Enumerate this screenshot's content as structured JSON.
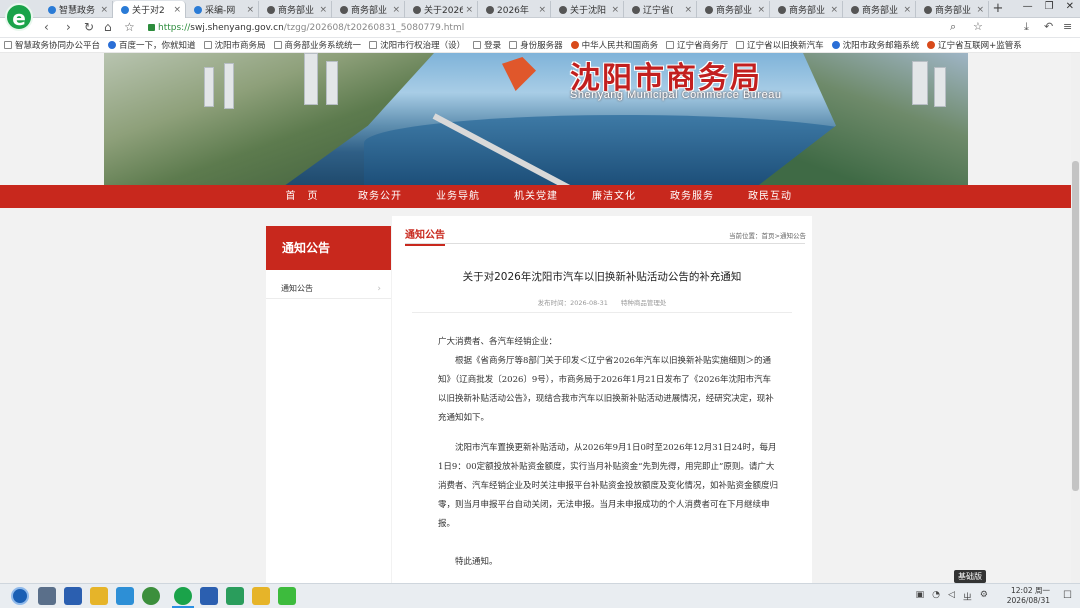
{
  "browser": {
    "logo_letter": "e",
    "tabs": [
      {
        "label": "智慧政务",
        "close": "×"
      },
      {
        "label": "关于对2",
        "close": "×",
        "active": true
      },
      {
        "label": "采编-网",
        "close": "×"
      },
      {
        "label": "商务部业",
        "close": "×"
      },
      {
        "label": "商务部业",
        "close": "×"
      },
      {
        "label": "关于2026",
        "close": "×"
      },
      {
        "label": "2026年",
        "close": "×"
      },
      {
        "label": "关于沈阳",
        "close": "×"
      },
      {
        "label": "辽宁省(",
        "close": "×"
      },
      {
        "label": "商务部业",
        "close": "×"
      },
      {
        "label": "商务部业",
        "close": "×"
      },
      {
        "label": "商务部业",
        "close": "×"
      },
      {
        "label": "商务部业",
        "close": "×"
      }
    ],
    "new_tab": "+",
    "url_scheme": "https://",
    "url_host": "swj.shenyang.gov.cn",
    "url_path": "/tzgg/202608/t20260831_5080779.html",
    "bookmarks": [
      "智慧政务协同办公平台",
      "百度一下，你就知道",
      "沈阳市商务局",
      "商务部业务系统统一",
      "沈阳市行权治理（设）",
      "登录",
      "身份服务器",
      "中华人民共和国商务",
      "辽宁省商务厅",
      "辽宁省以旧换新汽车",
      "沈阳市政务邮箱系统",
      "辽宁省互联网+监管系"
    ]
  },
  "site": {
    "title": "沈阳市商务局",
    "subtitle": "Shenyang Municipal Commerce Bureau",
    "nav": [
      "首　页",
      "政务公开",
      "业务导航",
      "机关党建",
      "廉洁文化",
      "政务服务",
      "政民互动"
    ],
    "sidebar": {
      "heading": "通知公告",
      "items": [
        {
          "label": "通知公告",
          "chevron": "›"
        }
      ]
    },
    "content": {
      "section_title": "通知公告",
      "breadcrumb": "当前位置：首页>通知公告",
      "article_title": "关于对2026年沈阳市汽车以旧换新补贴活动公告的补充通知",
      "meta": "发布时间：2026-08-31　　特种商品管理处",
      "salutation": "广大消费者、各汽车经销企业：",
      "para1": "根据《省商务厅等8部门关于印发＜辽宁省2026年汽车以旧换新补贴实施细则＞的通知》（辽商批发〔2026〕9号），市商务局于2026年1月21日发布了《2026年沈阳市汽车以旧换新补贴活动公告》，现结合我市汽车以旧换新补贴活动进展情况，经研究决定，现补充通知如下。",
      "para2": "沈阳市汽车置换更新补贴活动，从2026年9月1日0时至2026年12月31日24时，每月1日9：00定额投放补贴资金额度，实行当月补贴资金“先到先得，用完即止”原则。请广大消费者、汽车经销企业及时关注申报平台补贴资金投放额度及变化情况，如补贴资金额度归零，则当月申报平台自动关闭，无法申报。当月未申报成功的个人消费者可在下月继续申报。",
      "closing": "特此通知。"
    }
  },
  "taskbar": {
    "badge": "基础版",
    "time": "12:02 周一",
    "date": "2026/08/31"
  },
  "colors": {
    "brand_red": "#c8281d",
    "url_green": "#2c8c3c"
  }
}
